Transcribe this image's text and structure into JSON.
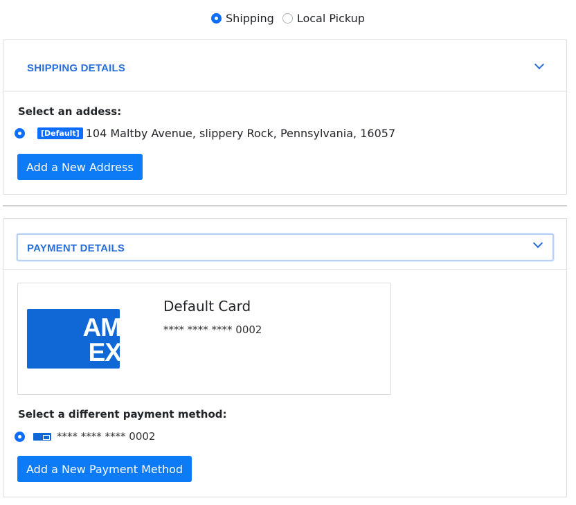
{
  "delivery": {
    "options": [
      {
        "label": "Shipping",
        "selected": true
      },
      {
        "label": "Local Pickup",
        "selected": false
      }
    ]
  },
  "shipping": {
    "title": "SHIPPING DETAILS",
    "select_label": "Select an addess:",
    "address": {
      "badge": "[Default]",
      "text": "104 Maltby Avenue, slippery Rock, Pennsylvania, 16057",
      "selected": true
    },
    "add_button": "Add a New Address"
  },
  "payment": {
    "title": "PAYMENT DETAILS",
    "default_card": {
      "brand_line1": "AM",
      "brand_line2": "EX",
      "title": "Default Card",
      "number": "**** **** **** 0002"
    },
    "select_label": "Select a different payment method:",
    "method": {
      "number": "**** **** **** 0002",
      "selected": true
    },
    "add_button": "Add a New Payment Method"
  },
  "colors": {
    "accent": "#0d6efd",
    "title_blue": "#2a6fd6",
    "amex_blue": "#1067d6"
  }
}
